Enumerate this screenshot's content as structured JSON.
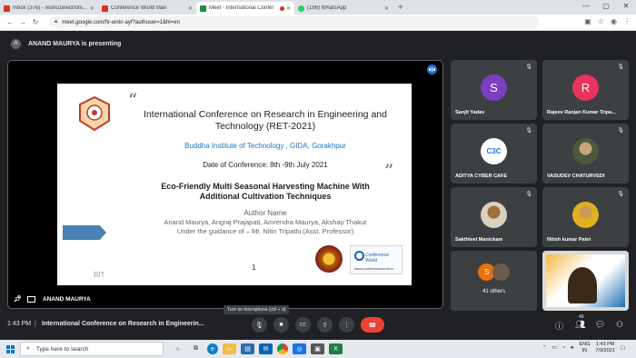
{
  "browser": {
    "tabs": [
      {
        "title": "Inbox (376) - reshu1electronics@",
        "color": "#d93025",
        "active": false
      },
      {
        "title": "Conference World Mail",
        "color": "#d93025",
        "active": false
      },
      {
        "title": "Meet - International Confer",
        "color": "#1e8e3e",
        "active": true,
        "recording": true
      },
      {
        "title": "(186) WhatsApp",
        "color": "#25d366",
        "active": false
      }
    ],
    "new_tab": "+",
    "url": "meet.google.com/fir-wnkr-ayf?authuser=1&hl=en"
  },
  "presenting": {
    "avatar_letter": "A",
    "text": "ANAND MAURYA is presenting"
  },
  "slide": {
    "title": "International Conference on Research in Engineering and Technology (RET-2021)",
    "institute": "Buddha Institute of Technology , GIDA, Gorakhpur",
    "date": "Date of Conference: 8th -9th July 2021",
    "paper_title": "Eco-Friendly Multi Seasonal Harvesting Machine With Additional Cultivation Techniques",
    "author_heading": "Author Name",
    "authors": "Anand Maurya, Angraj Prajapati, Amrendra Maurya, Akshay Thakur",
    "guidance": "Under the guidance of – Mr. Nitin Tripathi (Asst. Professor)",
    "footer_left": "BIT",
    "page_number": "1",
    "cw_name": "Conference World",
    "cw_url": "www.conferenceworld.in"
  },
  "main_tile": {
    "label": "ANAND MAURYA"
  },
  "participants": [
    {
      "name": "Sanjit Yadav",
      "initial": "S",
      "color": "#7b3fbf"
    },
    {
      "name": "Rajeev Ranjan Kumar Tripa...",
      "initial": "R",
      "color": "#e8335d"
    },
    {
      "name": "ADITYA CYBER CAFE",
      "initial": "C3C",
      "color": "#ffffff"
    },
    {
      "name": "VASUDEV CHATURVEDI",
      "initial": "",
      "color": "#4a5a3a"
    },
    {
      "name": "Sakthivel Manickam",
      "initial": "",
      "color": "#6b5b4b"
    },
    {
      "name": "Nitish kumar Patel",
      "initial": "",
      "color": "#8a7a3a"
    },
    {
      "name": "41 others",
      "initial": "S",
      "color": "#e8710a"
    },
    {
      "name": "",
      "initial": "",
      "color": "#c77b2a"
    }
  ],
  "controls": {
    "time": "1:43 PM",
    "separator": "|",
    "meeting_title": "International Conference on Research in Engineerin...",
    "tooltip": "Turn on microphone (ctrl + d)",
    "participant_count": "49"
  },
  "taskbar": {
    "search_placeholder": "Type here to search",
    "lang": "ENG",
    "region": "IN",
    "clock_time": "1:43 PM",
    "clock_date": "7/9/2021"
  }
}
